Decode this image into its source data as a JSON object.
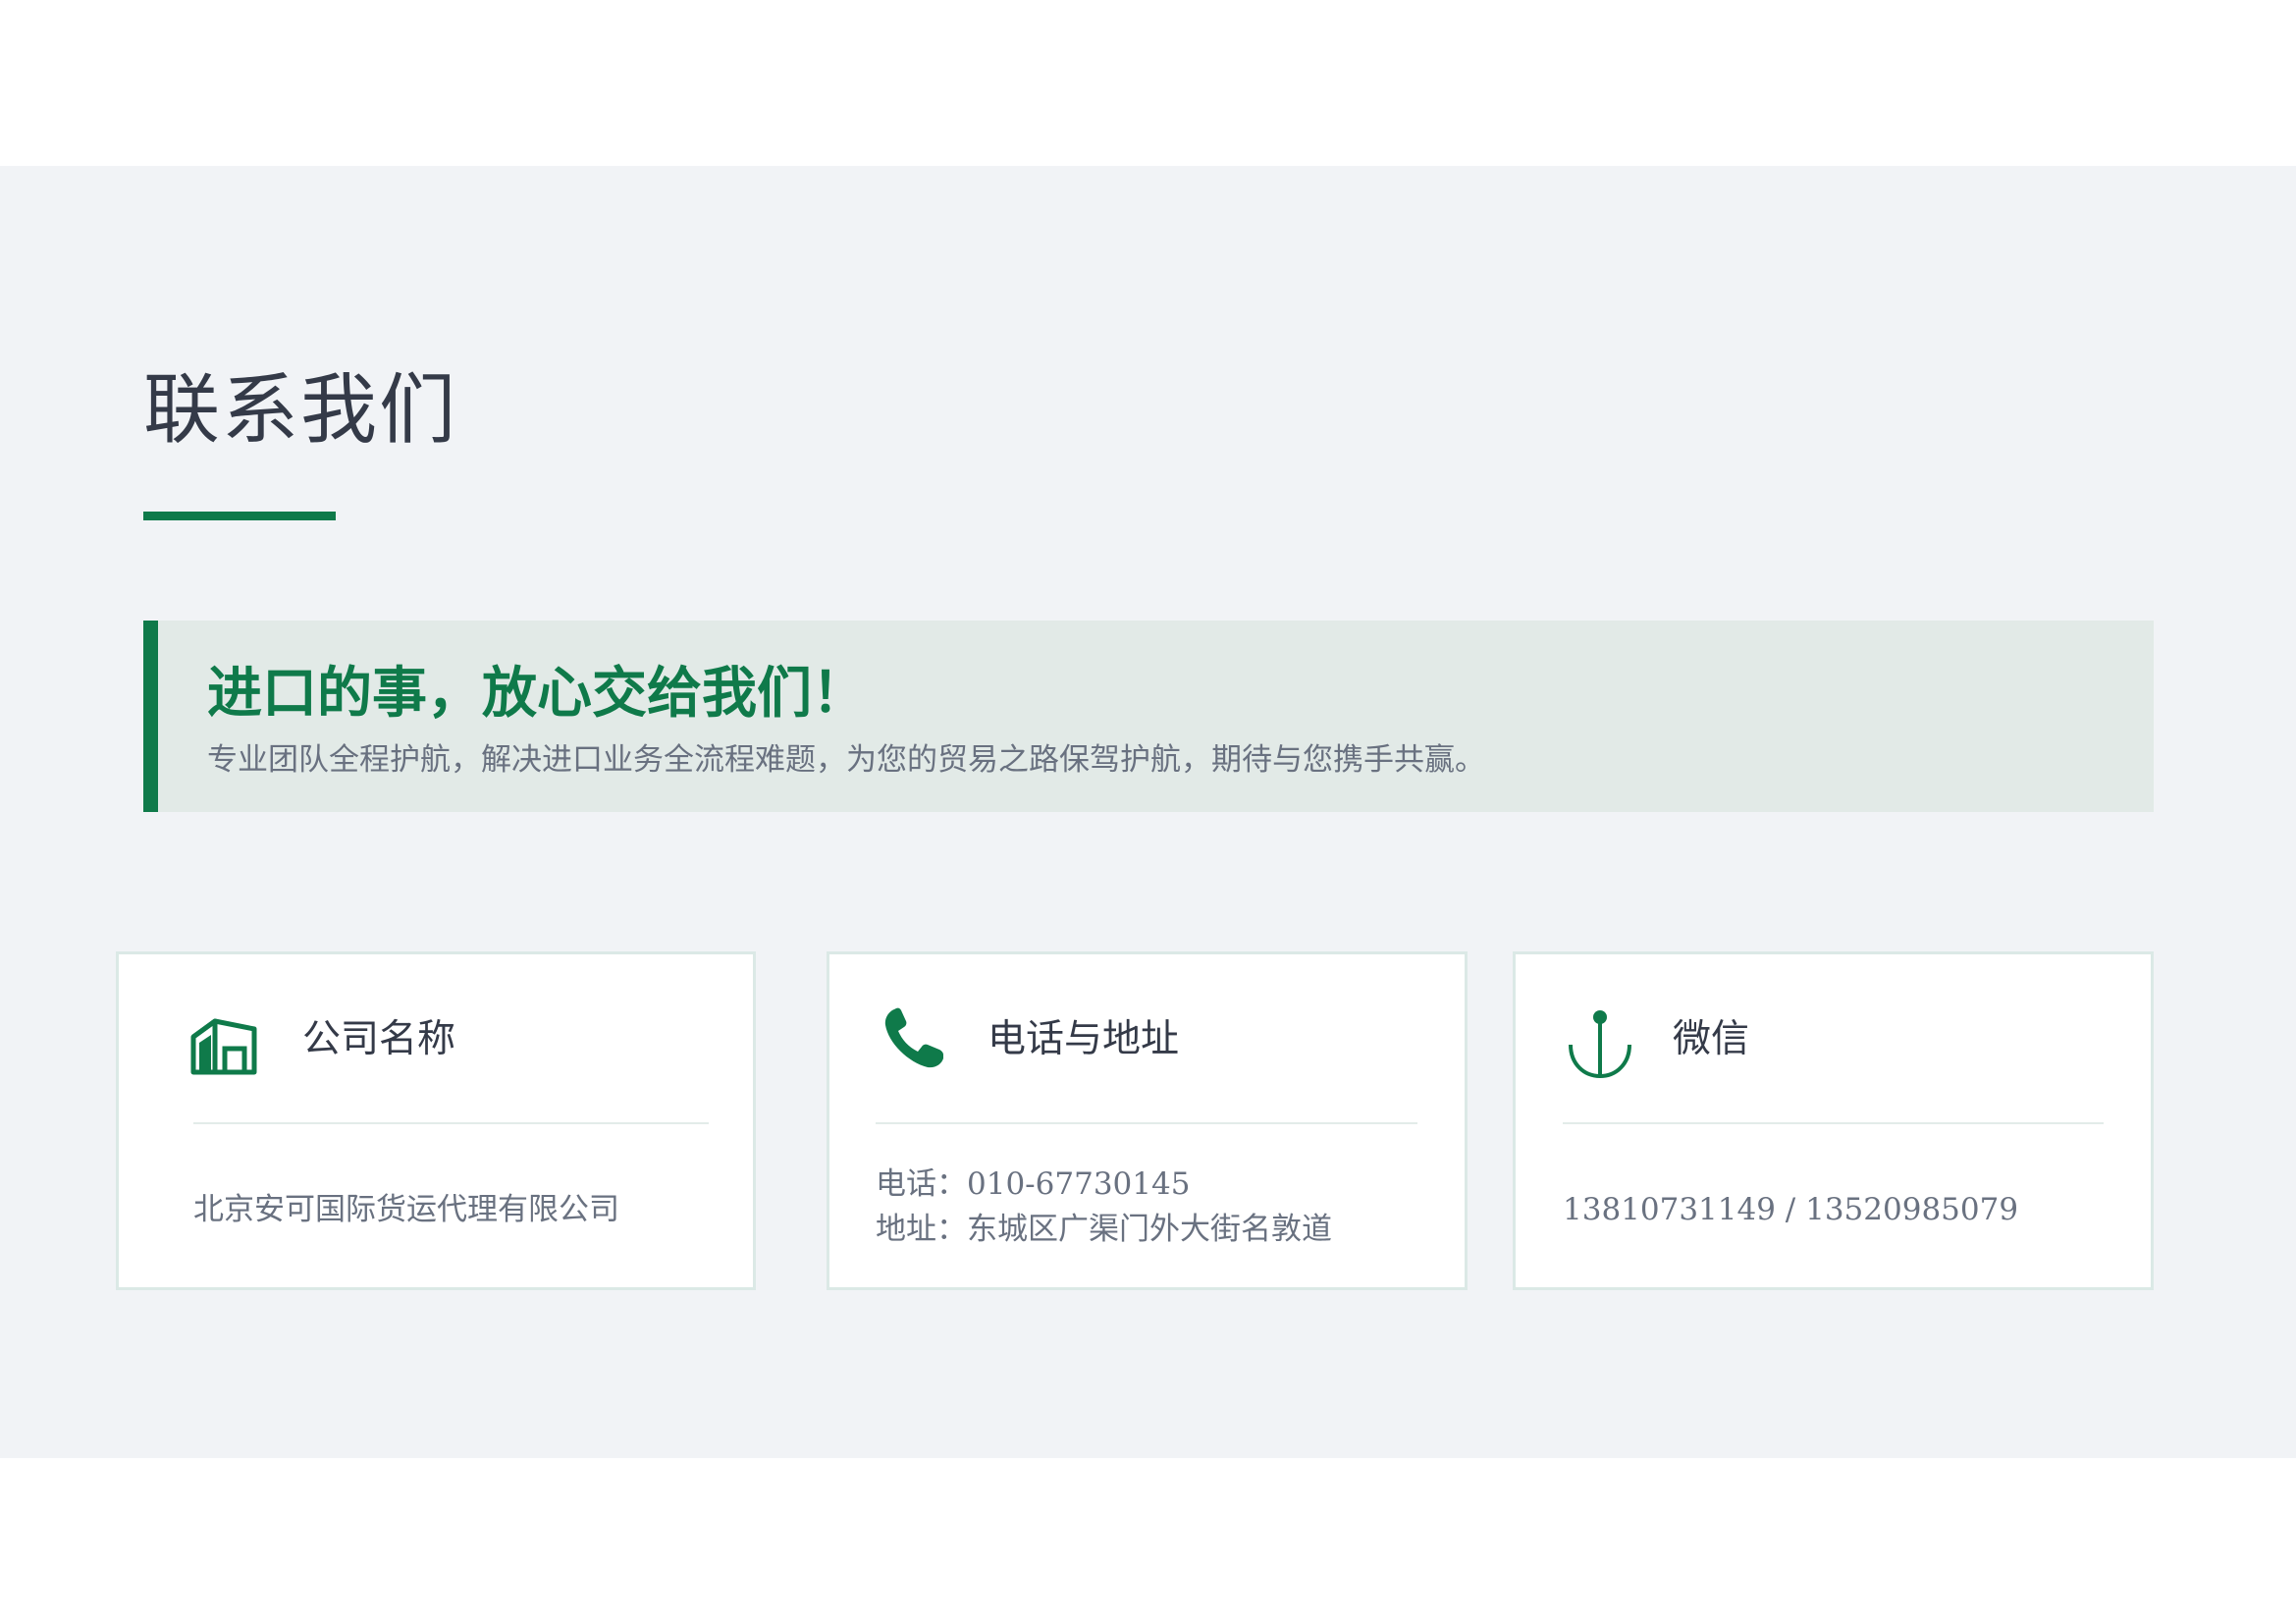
{
  "page": {
    "title": "联系我们"
  },
  "banner": {
    "headline": "进口的事，放心交给我们！",
    "subtext": "专业团队全程护航，解决进口业务全流程难题，为您的贸易之路保驾护航，期待与您携手共赢。"
  },
  "cards": {
    "company": {
      "icon": "warehouse-icon",
      "title": "公司名称",
      "value": "北京安可国际货运代理有限公司"
    },
    "contact": {
      "icon": "phone-icon",
      "title": "电话与地址",
      "phone": "电话：010-67730145",
      "address": "地址：东城区广渠门外大街名敦道"
    },
    "wechat": {
      "icon": "anchor-icon",
      "title": "微信",
      "value": "13810731149 / 13520985079"
    }
  },
  "colors": {
    "accent": "#0f7a4a",
    "background": "#f1f3f6",
    "banner_bg": "#e2eae7",
    "title_text": "#343a48",
    "body_text": "#697180"
  }
}
